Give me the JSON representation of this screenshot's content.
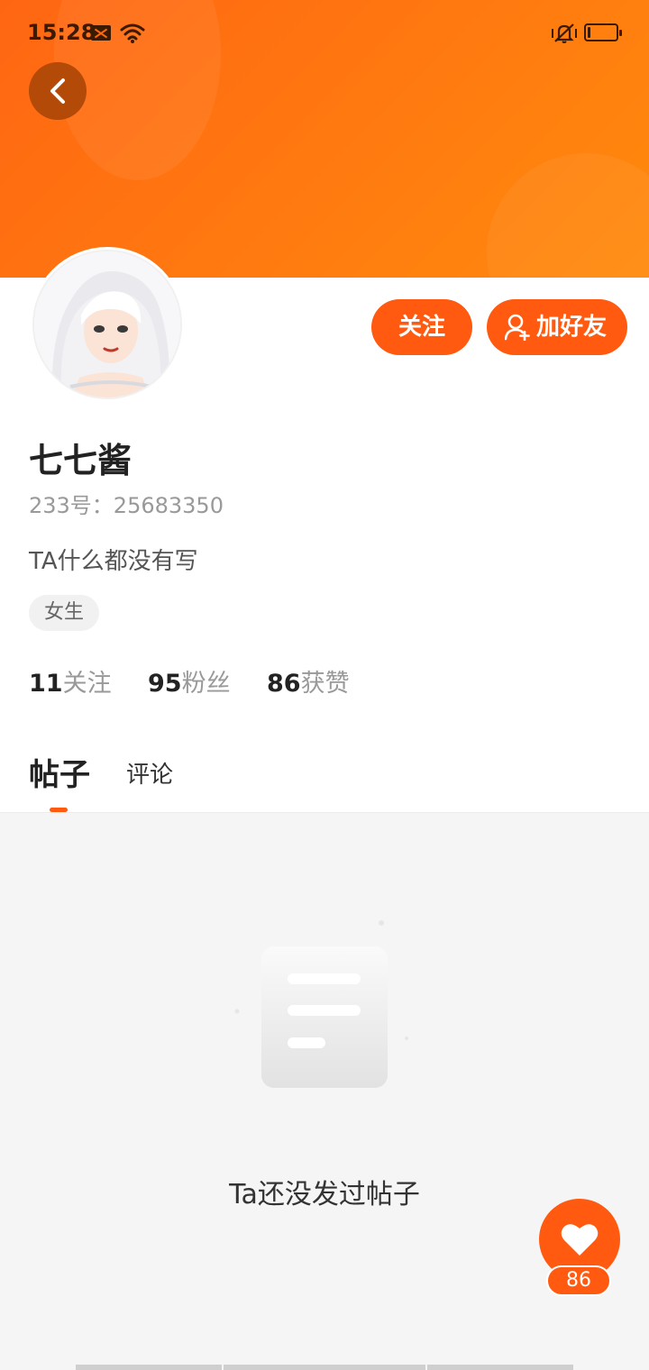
{
  "status_bar": {
    "time": "15:28",
    "icons": [
      "mail-icon",
      "wifi-icon",
      "vibrate-icon",
      "battery-icon"
    ]
  },
  "colors": {
    "accent": "#ff5a10",
    "header_gradient_start": "#ff6612",
    "header_gradient_end": "#ff8a0c",
    "back_button": "#b34a08"
  },
  "header": {
    "back_icon": "chevron-left-icon"
  },
  "profile": {
    "username": "七七酱",
    "uid": "233号：25683350",
    "bio": "TA什么都没有写",
    "tag": "女生",
    "actions": {
      "follow_label": "关注",
      "add_friend_label": "加好友",
      "add_friend_icon": "add-user-icon"
    },
    "stats": {
      "following_count": "11",
      "following_label": "关注",
      "followers_count": "95",
      "followers_label": "粉丝",
      "likes_count": "86",
      "likes_label": "获赞"
    }
  },
  "tabs": [
    {
      "label": "帖子",
      "active": true
    },
    {
      "label": "评论",
      "active": false
    }
  ],
  "empty_state": {
    "icon": "empty-document-icon",
    "message": "Ta还没发过帖子"
  },
  "like_button": {
    "icon": "heart-icon",
    "count": "86"
  }
}
